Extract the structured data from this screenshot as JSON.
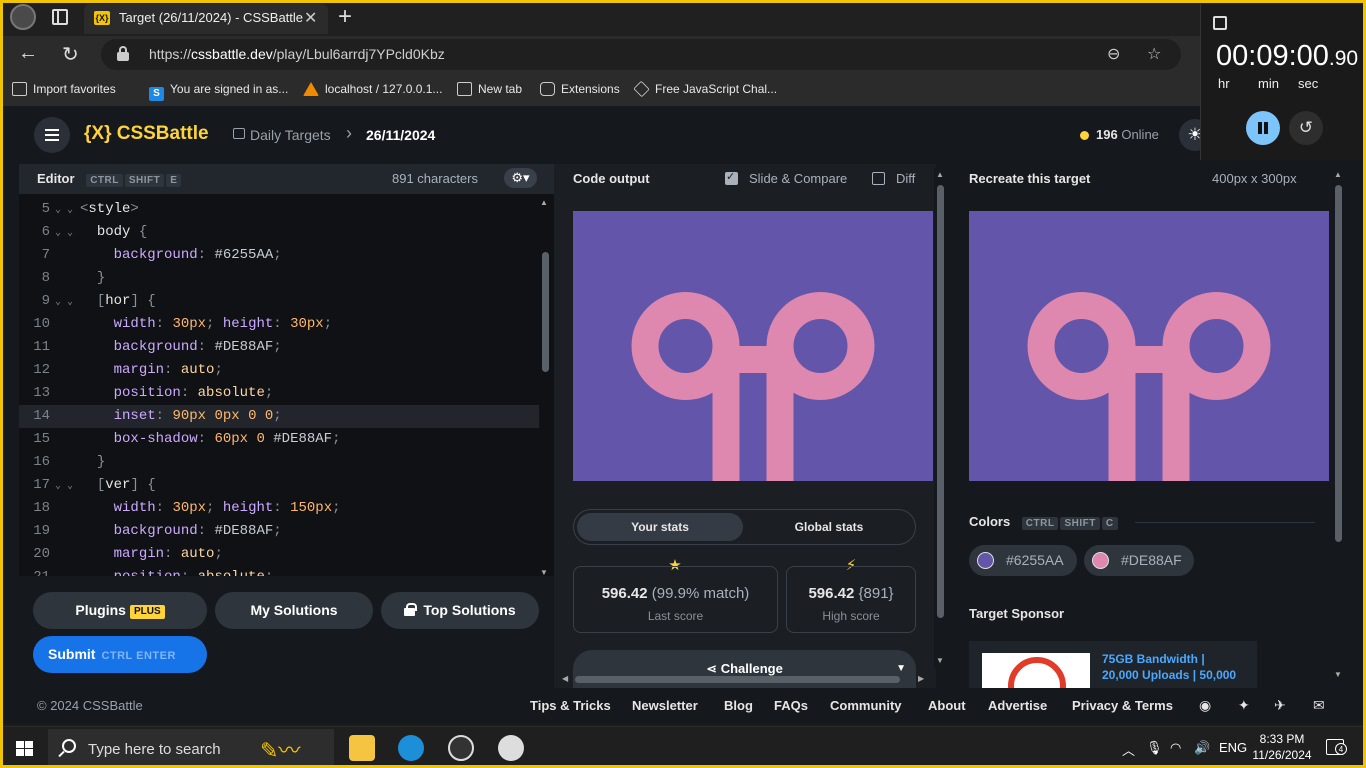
{
  "browser": {
    "tab_title": "Target (26/11/2024) - CSSBattle",
    "tab_favicon": "{X}",
    "url_prefix": "https://",
    "url_host": "cssbattle.dev",
    "url_path": "/play/Lbul6arrdj7YPcld0Kbz",
    "favorites": [
      {
        "label": "Import favorites",
        "icon": "import-icon"
      },
      {
        "label": "You are signed in as...",
        "icon": "s-icon"
      },
      {
        "label": "localhost / 127.0.0.1...",
        "icon": "phpmyadmin-icon"
      },
      {
        "label": "New tab",
        "icon": "newtab-icon"
      },
      {
        "label": "Extensions",
        "icon": "puzzle-icon"
      },
      {
        "label": "Free JavaScript Chal...",
        "icon": "cube-icon"
      }
    ]
  },
  "timer": {
    "main": "00:09:00",
    "fraction": ".90",
    "units": [
      "hr",
      "min",
      "sec"
    ]
  },
  "app": {
    "logo": "{X} CSSBattle",
    "crumb_section": "Daily Targets",
    "crumb_sep": "›",
    "crumb_date": "26/11/2024",
    "online_count": "196",
    "online_label": "Online"
  },
  "editor": {
    "title": "Editor",
    "shortcut": [
      "CTRL",
      "SHIFT",
      "E"
    ],
    "chars": "891 characters",
    "highlighted_line": 14,
    "lines": [
      {
        "n": "5",
        "fold": "⌄ ⌄",
        "indent": "",
        "parts": [
          [
            "t-punc",
            "<"
          ],
          [
            "t-tag",
            "style"
          ],
          [
            "t-punc",
            ">"
          ]
        ]
      },
      {
        "n": "6",
        "fold": "⌄ ⌄",
        "indent": "  ",
        "parts": [
          [
            "t-sel",
            "body"
          ],
          [
            "t-punc",
            " {"
          ]
        ]
      },
      {
        "n": "7",
        "fold": "",
        "indent": "    ",
        "parts": [
          [
            "t-prop",
            "background"
          ],
          [
            "t-punc",
            ": "
          ],
          [
            "t-hex",
            "#6255AA"
          ],
          [
            "t-punc",
            ";"
          ]
        ]
      },
      {
        "n": "8",
        "fold": "",
        "indent": "  ",
        "parts": [
          [
            "t-punc",
            "}"
          ]
        ]
      },
      {
        "n": "9",
        "fold": "⌄ ⌄",
        "indent": "  ",
        "parts": [
          [
            "t-punc",
            "["
          ],
          [
            "t-sel",
            "hor"
          ],
          [
            "t-punc",
            "] {"
          ]
        ]
      },
      {
        "n": "10",
        "fold": "",
        "indent": "    ",
        "parts": [
          [
            "t-prop",
            "width"
          ],
          [
            "t-punc",
            ": "
          ],
          [
            "t-num",
            "30px"
          ],
          [
            "t-punc",
            "; "
          ],
          [
            "t-prop",
            "height"
          ],
          [
            "t-punc",
            ": "
          ],
          [
            "t-num",
            "30px"
          ],
          [
            "t-punc",
            ";"
          ]
        ]
      },
      {
        "n": "11",
        "fold": "",
        "indent": "    ",
        "parts": [
          [
            "t-prop",
            "background"
          ],
          [
            "t-punc",
            ": "
          ],
          [
            "t-hex",
            "#DE88AF"
          ],
          [
            "t-punc",
            ";"
          ]
        ]
      },
      {
        "n": "12",
        "fold": "",
        "indent": "    ",
        "parts": [
          [
            "t-prop",
            "margin"
          ],
          [
            "t-punc",
            ": "
          ],
          [
            "t-val",
            "auto"
          ],
          [
            "t-punc",
            ";"
          ]
        ]
      },
      {
        "n": "13",
        "fold": "",
        "indent": "    ",
        "parts": [
          [
            "t-prop",
            "position"
          ],
          [
            "t-punc",
            ": "
          ],
          [
            "t-val",
            "absolute"
          ],
          [
            "t-punc",
            ";"
          ]
        ]
      },
      {
        "n": "14",
        "fold": "",
        "indent": "    ",
        "parts": [
          [
            "t-prop",
            "inset"
          ],
          [
            "t-punc",
            ": "
          ],
          [
            "t-num",
            "90px"
          ],
          [
            "t-punc",
            " "
          ],
          [
            "t-num",
            "0px"
          ],
          [
            "t-punc",
            " "
          ],
          [
            "t-num",
            "0"
          ],
          [
            "t-punc",
            " "
          ],
          [
            "t-num",
            "0"
          ],
          [
            "t-punc",
            ";"
          ]
        ]
      },
      {
        "n": "15",
        "fold": "",
        "indent": "    ",
        "parts": [
          [
            "t-prop",
            "box-shadow"
          ],
          [
            "t-punc",
            ": "
          ],
          [
            "t-num",
            "60px"
          ],
          [
            "t-punc",
            " "
          ],
          [
            "t-num",
            "0"
          ],
          [
            "t-punc",
            " "
          ],
          [
            "t-hex",
            "#DE88AF"
          ],
          [
            "t-punc",
            ";"
          ]
        ]
      },
      {
        "n": "16",
        "fold": "",
        "indent": "  ",
        "parts": [
          [
            "t-punc",
            "}"
          ]
        ]
      },
      {
        "n": "17",
        "fold": "⌄ ⌄",
        "indent": "  ",
        "parts": [
          [
            "t-punc",
            "["
          ],
          [
            "t-sel",
            "ver"
          ],
          [
            "t-punc",
            "] {"
          ]
        ]
      },
      {
        "n": "18",
        "fold": "",
        "indent": "    ",
        "parts": [
          [
            "t-prop",
            "width"
          ],
          [
            "t-punc",
            ": "
          ],
          [
            "t-num",
            "30px"
          ],
          [
            "t-punc",
            "; "
          ],
          [
            "t-prop",
            "height"
          ],
          [
            "t-punc",
            ": "
          ],
          [
            "t-num",
            "150px"
          ],
          [
            "t-punc",
            ";"
          ]
        ]
      },
      {
        "n": "19",
        "fold": "",
        "indent": "    ",
        "parts": [
          [
            "t-prop",
            "background"
          ],
          [
            "t-punc",
            ": "
          ],
          [
            "t-hex",
            "#DE88AF"
          ],
          [
            "t-punc",
            ";"
          ]
        ]
      },
      {
        "n": "20",
        "fold": "",
        "indent": "    ",
        "parts": [
          [
            "t-prop",
            "margin"
          ],
          [
            "t-punc",
            ": "
          ],
          [
            "t-val",
            "auto"
          ],
          [
            "t-punc",
            ";"
          ]
        ]
      },
      {
        "n": "21",
        "fold": "",
        "indent": "    ",
        "parts": [
          [
            "t-prop",
            "position"
          ],
          [
            "t-punc",
            ": "
          ],
          [
            "t-val",
            "absolute"
          ],
          [
            "t-punc",
            ";"
          ]
        ]
      }
    ]
  },
  "buttons": {
    "plugins": "Plugins",
    "plus_badge": "PLUS",
    "my_solutions": "My Solutions",
    "top_solutions": "Top Solutions",
    "submit": "Submit",
    "submit_keys": "CTRL   ENTER"
  },
  "output": {
    "title": "Code output",
    "slide_compare": "Slide & Compare",
    "slide_compare_checked": true,
    "diff": "Diff",
    "diff_checked": false,
    "your_stats": "Your stats",
    "global_stats": "Global stats",
    "last_score_value": "596.42",
    "last_score_extra": "(99.9% match)",
    "last_score_label": "Last score",
    "high_score_value": "596.42",
    "high_score_extra": "{891}",
    "high_score_label": "High score",
    "challenge": "Challenge"
  },
  "target": {
    "title": "Recreate this target",
    "size": "400px x 300px",
    "colors_title": "Colors",
    "colors_shortcut": [
      "CTRL",
      "SHIFT",
      "C"
    ],
    "colors": [
      "#6255AA",
      "#DE88AF"
    ],
    "sponsor_title": "Target Sponsor",
    "sponsor_text": "75GB Bandwidth |\n20,000 Uploads | 50,000"
  },
  "palette": {
    "bg": "#6255AA",
    "fg": "#DE88AF",
    "accent": "#ffd43a",
    "submit": "#1673e8"
  },
  "footer": {
    "copyright": "© 2024 CSSBattle",
    "links": [
      "Tips & Tricks",
      "Newsletter",
      "Blog",
      "FAQs",
      "Community",
      "About",
      "Advertise",
      "Privacy & Terms"
    ]
  },
  "taskbar": {
    "search_placeholder": "Type here to search",
    "lang": "ENG",
    "time": "8:33 PM",
    "date": "11/26/2024",
    "notifications": "4"
  }
}
